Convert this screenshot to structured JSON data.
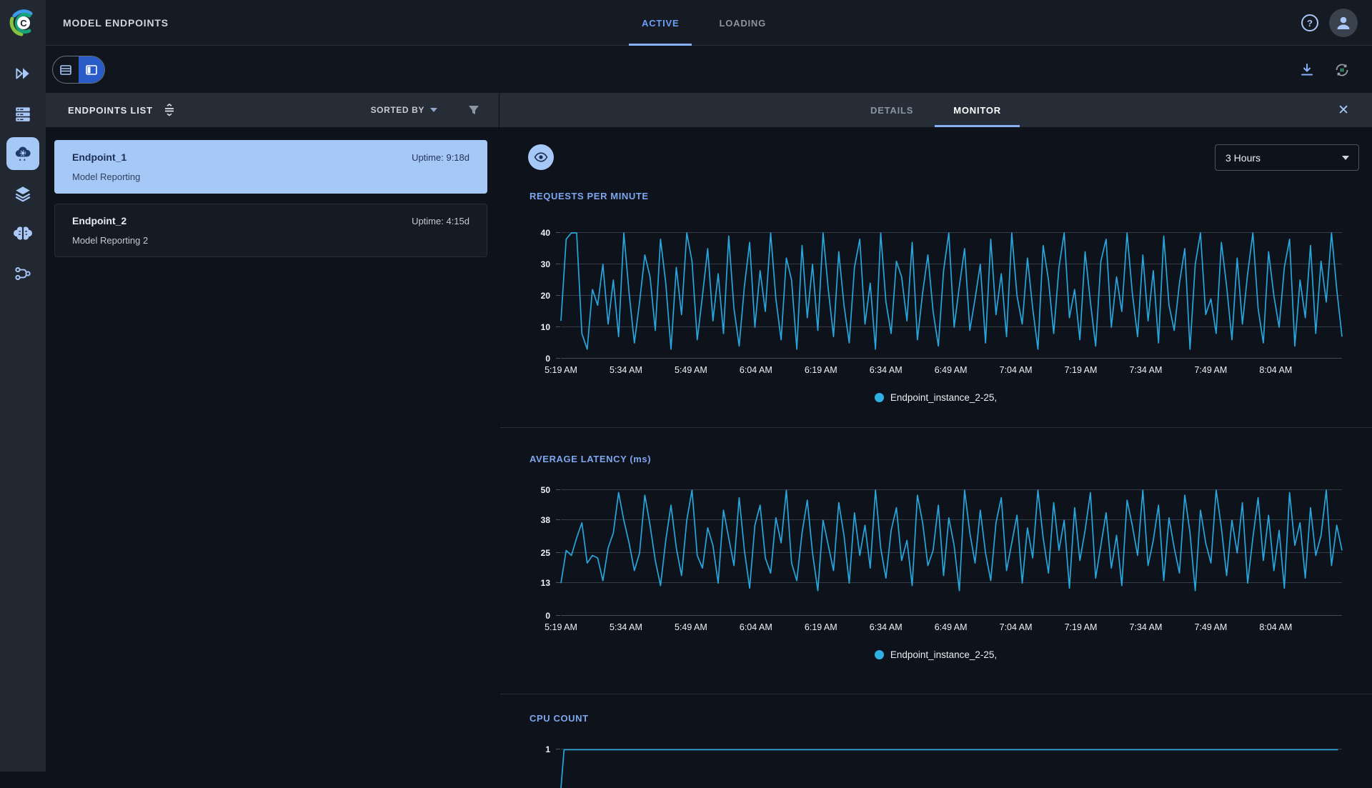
{
  "app": {
    "title": "MODEL ENDPOINTS"
  },
  "header": {
    "tabs": [
      {
        "label": "ACTIVE",
        "active": true
      },
      {
        "label": "LOADING",
        "active": false
      }
    ],
    "icons": [
      "help-icon",
      "user-avatar-icon"
    ]
  },
  "sidebar": {
    "icons": [
      "projects-icon",
      "workers-queues-icon",
      "model-serving-icon",
      "datasets-icon",
      "hyperdatasets-icon",
      "pipelines-icon"
    ],
    "active_icon": "model-serving-icon"
  },
  "toolbar": {
    "view_toggle": [
      "table-view-icon",
      "split-view-icon"
    ],
    "selected_view": "split-view-icon",
    "icons": [
      "download-icon",
      "auto-refresh-icon"
    ]
  },
  "endpoints_panel": {
    "title": "ENDPOINTS LIST",
    "sorted_by_label": "SORTED BY",
    "items": [
      {
        "name": "Endpoint_1",
        "uptime": "Uptime: 9:18d",
        "project": "Model Reporting",
        "selected": true
      },
      {
        "name": "Endpoint_2",
        "uptime": "Uptime: 4:15d",
        "project": "Model Reporting 2",
        "selected": false
      }
    ]
  },
  "monitor_panel": {
    "tabs": [
      {
        "label": "DETAILS",
        "active": false
      },
      {
        "label": "MONITOR",
        "active": true
      }
    ],
    "time_range_value": "3 Hours"
  },
  "chart_data": [
    {
      "type": "line",
      "title": "REQUESTS PER MINUTE",
      "legend": "Endpoint_instance_2-25,",
      "legend_position": "bottom-center",
      "color": "#28a5dd",
      "grid": true,
      "ylim": [
        0,
        40
      ],
      "yticks": [
        0,
        10,
        20,
        30,
        40
      ],
      "x_ticks": [
        "5:19 AM",
        "5:34 AM",
        "5:49 AM",
        "6:04 AM",
        "6:19 AM",
        "6:34 AM",
        "6:49 AM",
        "7:04 AM",
        "7:19 AM",
        "7:34 AM",
        "7:49 AM",
        "8:04 AM"
      ],
      "series": [
        {
          "name": "Endpoint_instance_2-25",
          "values": [
            12,
            38,
            40,
            40,
            8,
            3,
            22,
            17,
            30,
            11,
            25,
            7,
            40,
            21,
            5,
            18,
            33,
            26,
            9,
            38,
            24,
            3,
            29,
            14,
            40,
            31,
            6,
            20,
            35,
            12,
            27,
            8,
            39,
            16,
            4,
            23,
            37,
            10,
            28,
            15,
            40,
            19,
            6,
            32,
            25,
            3,
            36,
            13,
            30,
            9,
            40,
            22,
            7,
            34,
            17,
            5,
            29,
            38,
            11,
            24,
            3,
            40,
            18,
            8,
            31,
            26,
            12,
            37,
            6,
            21,
            33,
            15,
            4,
            28,
            40,
            10,
            23,
            35,
            9,
            19,
            30,
            5,
            38,
            14,
            27,
            7,
            40,
            20,
            11,
            32,
            16,
            3,
            36,
            25,
            8,
            29,
            40,
            13,
            22,
            6,
            34,
            18,
            4,
            31,
            38,
            10,
            26,
            15,
            40,
            21,
            7,
            33,
            12,
            28,
            5,
            39,
            17,
            9,
            24,
            35,
            3,
            30,
            40,
            14,
            19,
            8,
            37,
            23,
            6,
            32,
            11,
            27,
            40,
            16,
            5,
            34,
            20,
            10,
            29,
            38,
            4,
            25,
            13,
            36,
            8,
            31,
            18,
            40,
            22,
            7
          ]
        }
      ]
    },
    {
      "type": "line",
      "title": "AVERAGE LATENCY (ms)",
      "legend": "Endpoint_instance_2-25,",
      "legend_position": "bottom-center",
      "color": "#28a5dd",
      "grid": true,
      "ylim": [
        0,
        50
      ],
      "yticks": [
        0,
        13,
        25,
        38,
        50
      ],
      "x_ticks": [
        "5:19 AM",
        "5:34 AM",
        "5:49 AM",
        "6:04 AM",
        "6:19 AM",
        "6:34 AM",
        "6:49 AM",
        "7:04 AM",
        "7:19 AM",
        "7:34 AM",
        "7:49 AM",
        "8:04 AM"
      ],
      "series": [
        {
          "name": "Endpoint_instance_2-25",
          "values": [
            13,
            26,
            24,
            31,
            37,
            21,
            24,
            23,
            14,
            27,
            33,
            49,
            38,
            29,
            18,
            25,
            48,
            36,
            22,
            12,
            30,
            44,
            27,
            16,
            38,
            50,
            24,
            19,
            35,
            28,
            13,
            42,
            31,
            20,
            47,
            26,
            11,
            36,
            44,
            23,
            17,
            39,
            29,
            50,
            21,
            14,
            33,
            46,
            25,
            10,
            38,
            28,
            18,
            45,
            32,
            13,
            41,
            24,
            36,
            19,
            50,
            27,
            15,
            34,
            43,
            22,
            30,
            12,
            48,
            37,
            20,
            26,
            44,
            16,
            39,
            28,
            10,
            50,
            33,
            21,
            42,
            25,
            14,
            37,
            47,
            18,
            29,
            40,
            13,
            35,
            23,
            50,
            31,
            17,
            45,
            26,
            38,
            11,
            43,
            22,
            34,
            49,
            15,
            28,
            41,
            19,
            32,
            12,
            46,
            36,
            24,
            50,
            20,
            30,
            44,
            14,
            39,
            27,
            17,
            48,
            33,
            10,
            42,
            29,
            21,
            50,
            35,
            16,
            38,
            25,
            45,
            13,
            31,
            47,
            22,
            40,
            18,
            34,
            11,
            49,
            28,
            37,
            15,
            43,
            24,
            32,
            50,
            20,
            36,
            26
          ]
        }
      ]
    },
    {
      "type": "line",
      "title": "CPU COUNT",
      "color": "#28a5dd",
      "grid": true,
      "ylim": [
        0,
        1.12
      ],
      "yticks": [
        1
      ],
      "series": [
        {
          "name": "Endpoint_instance_2-25",
          "values": [
            [
              0,
              0
            ],
            [
              0.004,
              1
            ],
            [
              0.995,
              1
            ]
          ]
        }
      ]
    }
  ]
}
